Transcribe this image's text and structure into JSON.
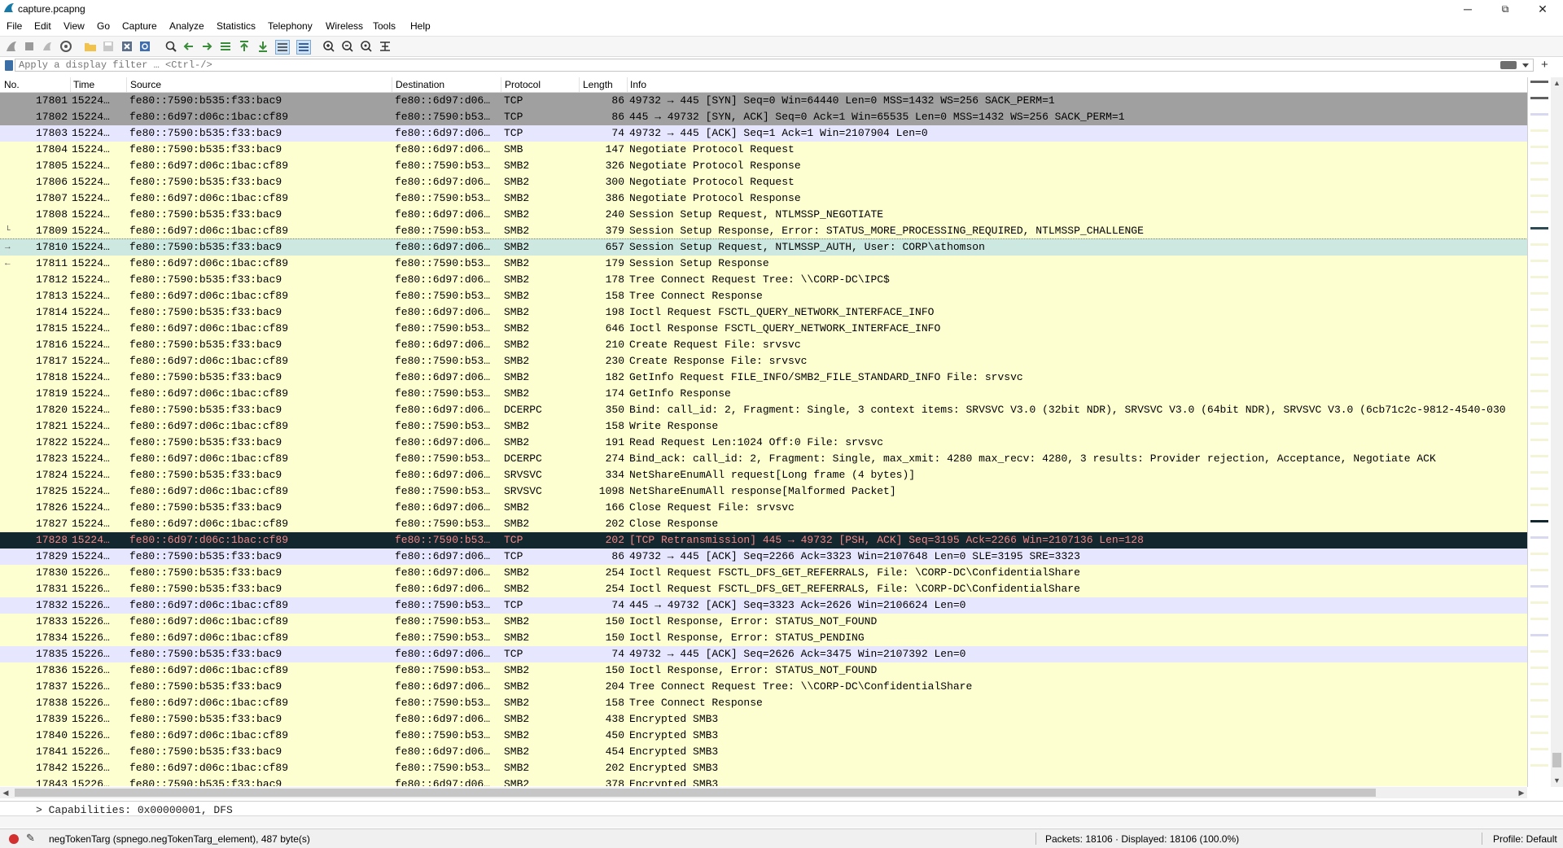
{
  "window": {
    "title": "capture.pcapng",
    "minimize": "─",
    "maximize": "⧉",
    "close": "✕"
  },
  "menu": [
    "File",
    "Edit",
    "View",
    "Go",
    "Capture",
    "Analyze",
    "Statistics",
    "Telephony",
    "Wireless",
    "Tools",
    "Help"
  ],
  "filter": {
    "placeholder": "Apply a display filter … <Ctrl-/>",
    "value": ""
  },
  "columns": [
    "No.",
    "Time",
    "Source",
    "Destination",
    "Protocol",
    "Length",
    "Info"
  ],
  "packets": [
    {
      "no": "17801",
      "time": "15224…",
      "src": "fe80::7590:b535:f33:bac9",
      "dst": "fe80::6d97:d06…",
      "proto": "TCP",
      "len": "86",
      "info": "49732 → 445 [SYN] Seq=0 Win=64440 Len=0 MSS=1432 WS=256 SACK_PERM=1",
      "rel": ""
    },
    {
      "no": "17802",
      "time": "15224…",
      "src": "fe80::6d97:d06c:1bac:cf89",
      "dst": "fe80::7590:b53…",
      "proto": "TCP",
      "len": "86",
      "info": "445 → 49732 [SYN, ACK] Seq=0 Ack=1 Win=65535 Len=0 MSS=1432 WS=256 SACK_PERM=1",
      "rel": ""
    },
    {
      "no": "17803",
      "time": "15224…",
      "src": "fe80::7590:b535:f33:bac9",
      "dst": "fe80::6d97:d06…",
      "proto": "TCP",
      "len": "74",
      "info": "49732 → 445 [ACK] Seq=1 Ack=1 Win=2107904 Len=0",
      "rel": ""
    },
    {
      "no": "17804",
      "time": "15224…",
      "src": "fe80::7590:b535:f33:bac9",
      "dst": "fe80::6d97:d06…",
      "proto": "SMB",
      "len": "147",
      "info": "Negotiate Protocol Request",
      "rel": ""
    },
    {
      "no": "17805",
      "time": "15224…",
      "src": "fe80::6d97:d06c:1bac:cf89",
      "dst": "fe80::7590:b53…",
      "proto": "SMB2",
      "len": "326",
      "info": "Negotiate Protocol Response",
      "rel": ""
    },
    {
      "no": "17806",
      "time": "15224…",
      "src": "fe80::7590:b535:f33:bac9",
      "dst": "fe80::6d97:d06…",
      "proto": "SMB2",
      "len": "300",
      "info": "Negotiate Protocol Request",
      "rel": ""
    },
    {
      "no": "17807",
      "time": "15224…",
      "src": "fe80::6d97:d06c:1bac:cf89",
      "dst": "fe80::7590:b53…",
      "proto": "SMB2",
      "len": "386",
      "info": "Negotiate Protocol Response",
      "rel": ""
    },
    {
      "no": "17808",
      "time": "15224…",
      "src": "fe80::7590:b535:f33:bac9",
      "dst": "fe80::6d97:d06…",
      "proto": "SMB2",
      "len": "240",
      "info": "Session Setup Request, NTLMSSP_NEGOTIATE",
      "rel": ""
    },
    {
      "no": "17809",
      "time": "15224…",
      "src": "fe80::6d97:d06c:1bac:cf89",
      "dst": "fe80::7590:b53…",
      "proto": "SMB2",
      "len": "379",
      "info": "Session Setup Response, Error: STATUS_MORE_PROCESSING_REQUIRED, NTLMSSP_CHALLENGE",
      "rel": "└"
    },
    {
      "no": "17810",
      "time": "15224…",
      "src": "fe80::7590:b535:f33:bac9",
      "dst": "fe80::6d97:d06…",
      "proto": "SMB2",
      "len": "657",
      "info": "Session Setup Request, NTLMSSP_AUTH, User: CORP\\athomson",
      "rel": "→"
    },
    {
      "no": "17811",
      "time": "15224…",
      "src": "fe80::6d97:d06c:1bac:cf89",
      "dst": "fe80::7590:b53…",
      "proto": "SMB2",
      "len": "179",
      "info": "Session Setup Response",
      "rel": "←"
    },
    {
      "no": "17812",
      "time": "15224…",
      "src": "fe80::7590:b535:f33:bac9",
      "dst": "fe80::6d97:d06…",
      "proto": "SMB2",
      "len": "178",
      "info": "Tree Connect Request Tree: \\\\CORP-DC\\IPC$",
      "rel": ""
    },
    {
      "no": "17813",
      "time": "15224…",
      "src": "fe80::6d97:d06c:1bac:cf89",
      "dst": "fe80::7590:b53…",
      "proto": "SMB2",
      "len": "158",
      "info": "Tree Connect Response",
      "rel": ""
    },
    {
      "no": "17814",
      "time": "15224…",
      "src": "fe80::7590:b535:f33:bac9",
      "dst": "fe80::6d97:d06…",
      "proto": "SMB2",
      "len": "198",
      "info": "Ioctl Request FSCTL_QUERY_NETWORK_INTERFACE_INFO",
      "rel": ""
    },
    {
      "no": "17815",
      "time": "15224…",
      "src": "fe80::6d97:d06c:1bac:cf89",
      "dst": "fe80::7590:b53…",
      "proto": "SMB2",
      "len": "646",
      "info": "Ioctl Response FSCTL_QUERY_NETWORK_INTERFACE_INFO",
      "rel": ""
    },
    {
      "no": "17816",
      "time": "15224…",
      "src": "fe80::7590:b535:f33:bac9",
      "dst": "fe80::6d97:d06…",
      "proto": "SMB2",
      "len": "210",
      "info": "Create Request File: srvsvc",
      "rel": ""
    },
    {
      "no": "17817",
      "time": "15224…",
      "src": "fe80::6d97:d06c:1bac:cf89",
      "dst": "fe80::7590:b53…",
      "proto": "SMB2",
      "len": "230",
      "info": "Create Response File: srvsvc",
      "rel": ""
    },
    {
      "no": "17818",
      "time": "15224…",
      "src": "fe80::7590:b535:f33:bac9",
      "dst": "fe80::6d97:d06…",
      "proto": "SMB2",
      "len": "182",
      "info": "GetInfo Request FILE_INFO/SMB2_FILE_STANDARD_INFO File: srvsvc",
      "rel": ""
    },
    {
      "no": "17819",
      "time": "15224…",
      "src": "fe80::6d97:d06c:1bac:cf89",
      "dst": "fe80::7590:b53…",
      "proto": "SMB2",
      "len": "174",
      "info": "GetInfo Response",
      "rel": ""
    },
    {
      "no": "17820",
      "time": "15224…",
      "src": "fe80::7590:b535:f33:bac9",
      "dst": "fe80::6d97:d06…",
      "proto": "DCERPC",
      "len": "350",
      "info": "Bind: call_id: 2, Fragment: Single, 3 context items: SRVSVC V3.0 (32bit NDR), SRVSVC V3.0 (64bit NDR), SRVSVC V3.0 (6cb71c2c-9812-4540-030",
      "rel": ""
    },
    {
      "no": "17821",
      "time": "15224…",
      "src": "fe80::6d97:d06c:1bac:cf89",
      "dst": "fe80::7590:b53…",
      "proto": "SMB2",
      "len": "158",
      "info": "Write Response",
      "rel": ""
    },
    {
      "no": "17822",
      "time": "15224…",
      "src": "fe80::7590:b535:f33:bac9",
      "dst": "fe80::6d97:d06…",
      "proto": "SMB2",
      "len": "191",
      "info": "Read Request Len:1024 Off:0 File: srvsvc",
      "rel": ""
    },
    {
      "no": "17823",
      "time": "15224…",
      "src": "fe80::6d97:d06c:1bac:cf89",
      "dst": "fe80::7590:b53…",
      "proto": "DCERPC",
      "len": "274",
      "info": "Bind_ack: call_id: 2, Fragment: Single, max_xmit: 4280 max_recv: 4280, 3 results: Provider rejection, Acceptance, Negotiate ACK",
      "rel": ""
    },
    {
      "no": "17824",
      "time": "15224…",
      "src": "fe80::7590:b535:f33:bac9",
      "dst": "fe80::6d97:d06…",
      "proto": "SRVSVC",
      "len": "334",
      "info": "NetShareEnumAll request[Long frame (4 bytes)]",
      "rel": ""
    },
    {
      "no": "17825",
      "time": "15224…",
      "src": "fe80::6d97:d06c:1bac:cf89",
      "dst": "fe80::7590:b53…",
      "proto": "SRVSVC",
      "len": "1098",
      "info": "NetShareEnumAll response[Malformed Packet]",
      "rel": ""
    },
    {
      "no": "17826",
      "time": "15224…",
      "src": "fe80::7590:b535:f33:bac9",
      "dst": "fe80::6d97:d06…",
      "proto": "SMB2",
      "len": "166",
      "info": "Close Request File: srvsvc",
      "rel": ""
    },
    {
      "no": "17827",
      "time": "15224…",
      "src": "fe80::6d97:d06c:1bac:cf89",
      "dst": "fe80::7590:b53…",
      "proto": "SMB2",
      "len": "202",
      "info": "Close Response",
      "rel": ""
    },
    {
      "no": "17828",
      "time": "15224…",
      "src": "fe80::6d97:d06c:1bac:cf89",
      "dst": "fe80::7590:b53…",
      "proto": "TCP",
      "len": "202",
      "info": "[TCP Retransmission] 445 → 49732 [PSH, ACK] Seq=3195 Ack=2266 Win=2107136 Len=128",
      "rel": ""
    },
    {
      "no": "17829",
      "time": "15224…",
      "src": "fe80::7590:b535:f33:bac9",
      "dst": "fe80::6d97:d06…",
      "proto": "TCP",
      "len": "86",
      "info": "49732 → 445 [ACK] Seq=2266 Ack=3323 Win=2107648 Len=0 SLE=3195 SRE=3323",
      "rel": ""
    },
    {
      "no": "17830",
      "time": "15226…",
      "src": "fe80::7590:b535:f33:bac9",
      "dst": "fe80::6d97:d06…",
      "proto": "SMB2",
      "len": "254",
      "info": "Ioctl Request FSCTL_DFS_GET_REFERRALS, File: \\CORP-DC\\ConfidentialShare",
      "rel": ""
    },
    {
      "no": "17831",
      "time": "15226…",
      "src": "fe80::7590:b535:f33:bac9",
      "dst": "fe80::6d97:d06…",
      "proto": "SMB2",
      "len": "254",
      "info": "Ioctl Request FSCTL_DFS_GET_REFERRALS, File: \\CORP-DC\\ConfidentialShare",
      "rel": ""
    },
    {
      "no": "17832",
      "time": "15226…",
      "src": "fe80::6d97:d06c:1bac:cf89",
      "dst": "fe80::7590:b53…",
      "proto": "TCP",
      "len": "74",
      "info": "445 → 49732 [ACK] Seq=3323 Ack=2626 Win=2106624 Len=0",
      "rel": ""
    },
    {
      "no": "17833",
      "time": "15226…",
      "src": "fe80::6d97:d06c:1bac:cf89",
      "dst": "fe80::7590:b53…",
      "proto": "SMB2",
      "len": "150",
      "info": "Ioctl Response, Error: STATUS_NOT_FOUND",
      "rel": ""
    },
    {
      "no": "17834",
      "time": "15226…",
      "src": "fe80::6d97:d06c:1bac:cf89",
      "dst": "fe80::7590:b53…",
      "proto": "SMB2",
      "len": "150",
      "info": "Ioctl Response, Error: STATUS_PENDING",
      "rel": ""
    },
    {
      "no": "17835",
      "time": "15226…",
      "src": "fe80::7590:b535:f33:bac9",
      "dst": "fe80::6d97:d06…",
      "proto": "TCP",
      "len": "74",
      "info": "49732 → 445 [ACK] Seq=2626 Ack=3475 Win=2107392 Len=0",
      "rel": ""
    },
    {
      "no": "17836",
      "time": "15226…",
      "src": "fe80::6d97:d06c:1bac:cf89",
      "dst": "fe80::7590:b53…",
      "proto": "SMB2",
      "len": "150",
      "info": "Ioctl Response, Error: STATUS_NOT_FOUND",
      "rel": ""
    },
    {
      "no": "17837",
      "time": "15226…",
      "src": "fe80::7590:b535:f33:bac9",
      "dst": "fe80::6d97:d06…",
      "proto": "SMB2",
      "len": "204",
      "info": "Tree Connect Request Tree: \\\\CORP-DC\\ConfidentialShare",
      "rel": ""
    },
    {
      "no": "17838",
      "time": "15226…",
      "src": "fe80::6d97:d06c:1bac:cf89",
      "dst": "fe80::7590:b53…",
      "proto": "SMB2",
      "len": "158",
      "info": "Tree Connect Response",
      "rel": ""
    },
    {
      "no": "17839",
      "time": "15226…",
      "src": "fe80::7590:b535:f33:bac9",
      "dst": "fe80::6d97:d06…",
      "proto": "SMB2",
      "len": "438",
      "info": "Encrypted SMB3",
      "rel": ""
    },
    {
      "no": "17840",
      "time": "15226…",
      "src": "fe80::6d97:d06c:1bac:cf89",
      "dst": "fe80::7590:b53…",
      "proto": "SMB2",
      "len": "450",
      "info": "Encrypted SMB3",
      "rel": ""
    },
    {
      "no": "17841",
      "time": "15226…",
      "src": "fe80::7590:b535:f33:bac9",
      "dst": "fe80::6d97:d06…",
      "proto": "SMB2",
      "len": "454",
      "info": "Encrypted SMB3",
      "rel": ""
    },
    {
      "no": "17842",
      "time": "15226…",
      "src": "fe80::6d97:d06c:1bac:cf89",
      "dst": "fe80::7590:b53…",
      "proto": "SMB2",
      "len": "202",
      "info": "Encrypted SMB3",
      "rel": ""
    },
    {
      "no": "17843",
      "time": "15226…",
      "src": "fe80::7590:b535:f33:bac9",
      "dst": "fe80::6d97:d06…",
      "proto": "SMB2",
      "len": "378",
      "info": "Encrypted SMB3",
      "rel": ""
    }
  ],
  "colors": {
    "tcp_syn": "#a0a0a0",
    "tcp": "#e7e6ff",
    "smb": "#feffd0",
    "selected": "#cde8e0",
    "bad": "#12272e",
    "bad_text": "#f78787"
  },
  "detail": {
    "text": "> Capabilities: 0x00000001, DFS"
  },
  "status": {
    "expert_info": "negTokenTarg (spnego.negTokenTarg_element), 487 byte(s)",
    "packets": "Packets: 18106 · Displayed: 18106 (100.0%)",
    "profile": "Profile: Default"
  }
}
